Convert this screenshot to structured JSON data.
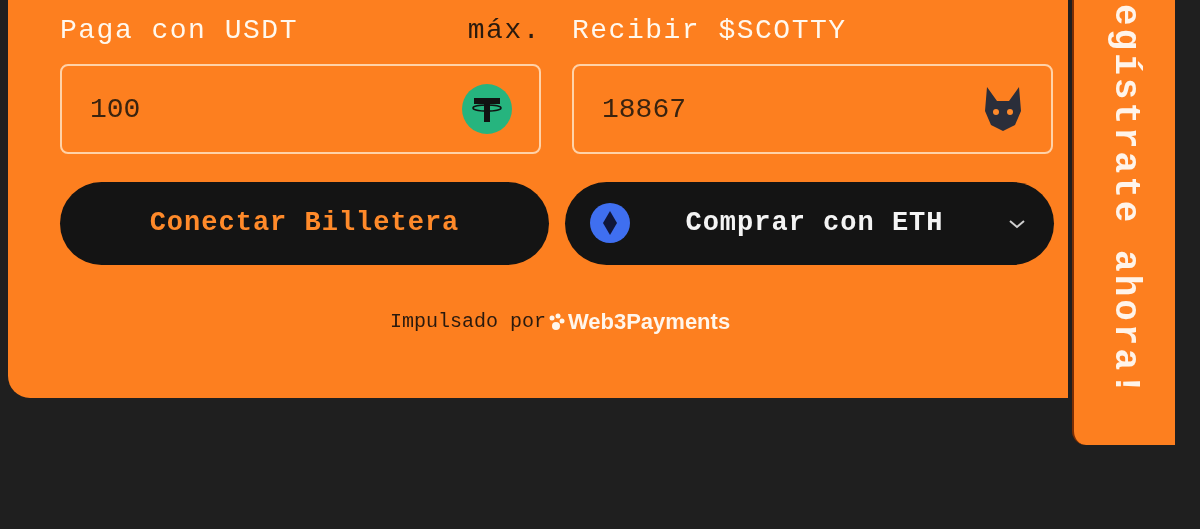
{
  "form": {
    "pay_label": "Paga con USDT",
    "max_label": "máx.",
    "receive_label": "Recibir $SCOTTY",
    "pay_amount": "100",
    "receive_amount": "18867"
  },
  "buttons": [
    {
      "kind": "connect",
      "label": "Conectar Billetera"
    },
    {
      "kind": "currency",
      "label": "Comprar con ETH"
    }
  ],
  "footer": {
    "prefix": "Impulsado por",
    "brand": "Web3Payments"
  },
  "side_tab": {
    "label": "egístrate ahora!"
  }
}
